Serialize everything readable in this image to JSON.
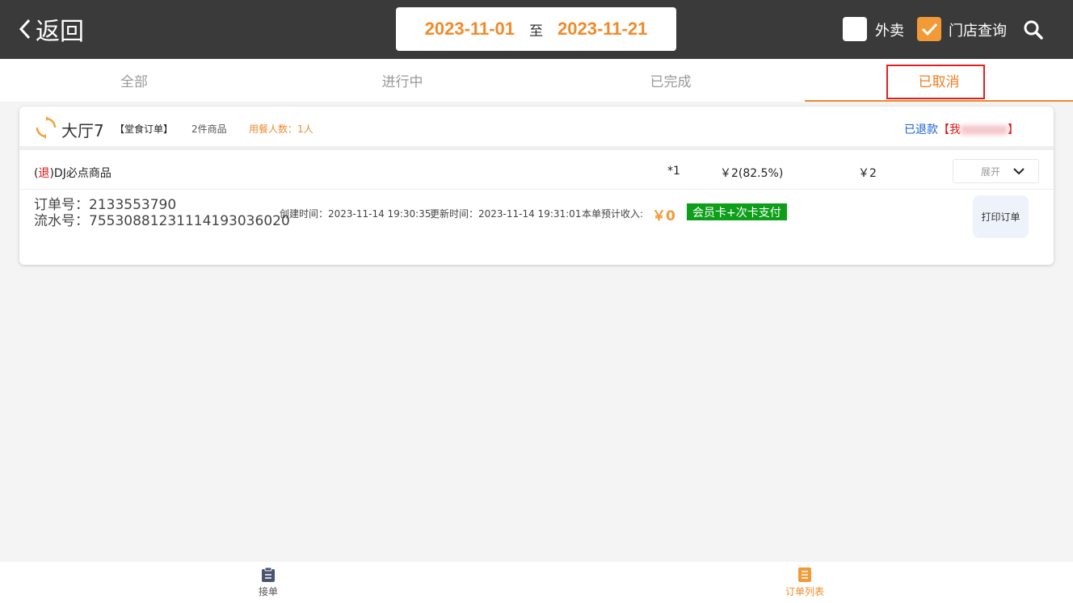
{
  "header": {
    "back_label": "返回",
    "date_from": "2023-11-01",
    "date_sep": "至",
    "date_to": "2023-11-21",
    "takeout_label": "外卖",
    "takeout_checked": false,
    "store_query_label": "门店查询",
    "store_query_checked": true,
    "accent": "#f08a2a"
  },
  "tabs": [
    {
      "label": "全部",
      "active": false
    },
    {
      "label": "进行中",
      "active": false
    },
    {
      "label": "已完成",
      "active": false
    },
    {
      "label": "已取消",
      "active": true
    }
  ],
  "order": {
    "hall": "大厅7",
    "type": "【堂食订单】",
    "item_count": "2件商品",
    "diners": "用餐人数：1人",
    "status": "已退款",
    "status_open": "【我",
    "status_close": "】",
    "item": {
      "refund_prefix": "(",
      "refund_tag": "退",
      "name": ")DJ必点商品",
      "qty": "*1",
      "price": "￥2(82.5%)",
      "total": "￥2"
    },
    "expand_label": "展开",
    "order_no": "订单号：2133553790",
    "serial_no": "流水号：755308812311141930360​20",
    "created": "创建时间：2023-11-14 19:30:35",
    "updated": "更新时间：2023-11-14 19:31:01",
    "income_label": "本单预计收入:",
    "income_amount": "￥0",
    "pay_method": "会员卡+次卡支付",
    "print_label": "打印订单"
  },
  "bottom_nav": [
    {
      "label": "接单",
      "active": false
    },
    {
      "label": "订单列表",
      "active": true
    }
  ]
}
